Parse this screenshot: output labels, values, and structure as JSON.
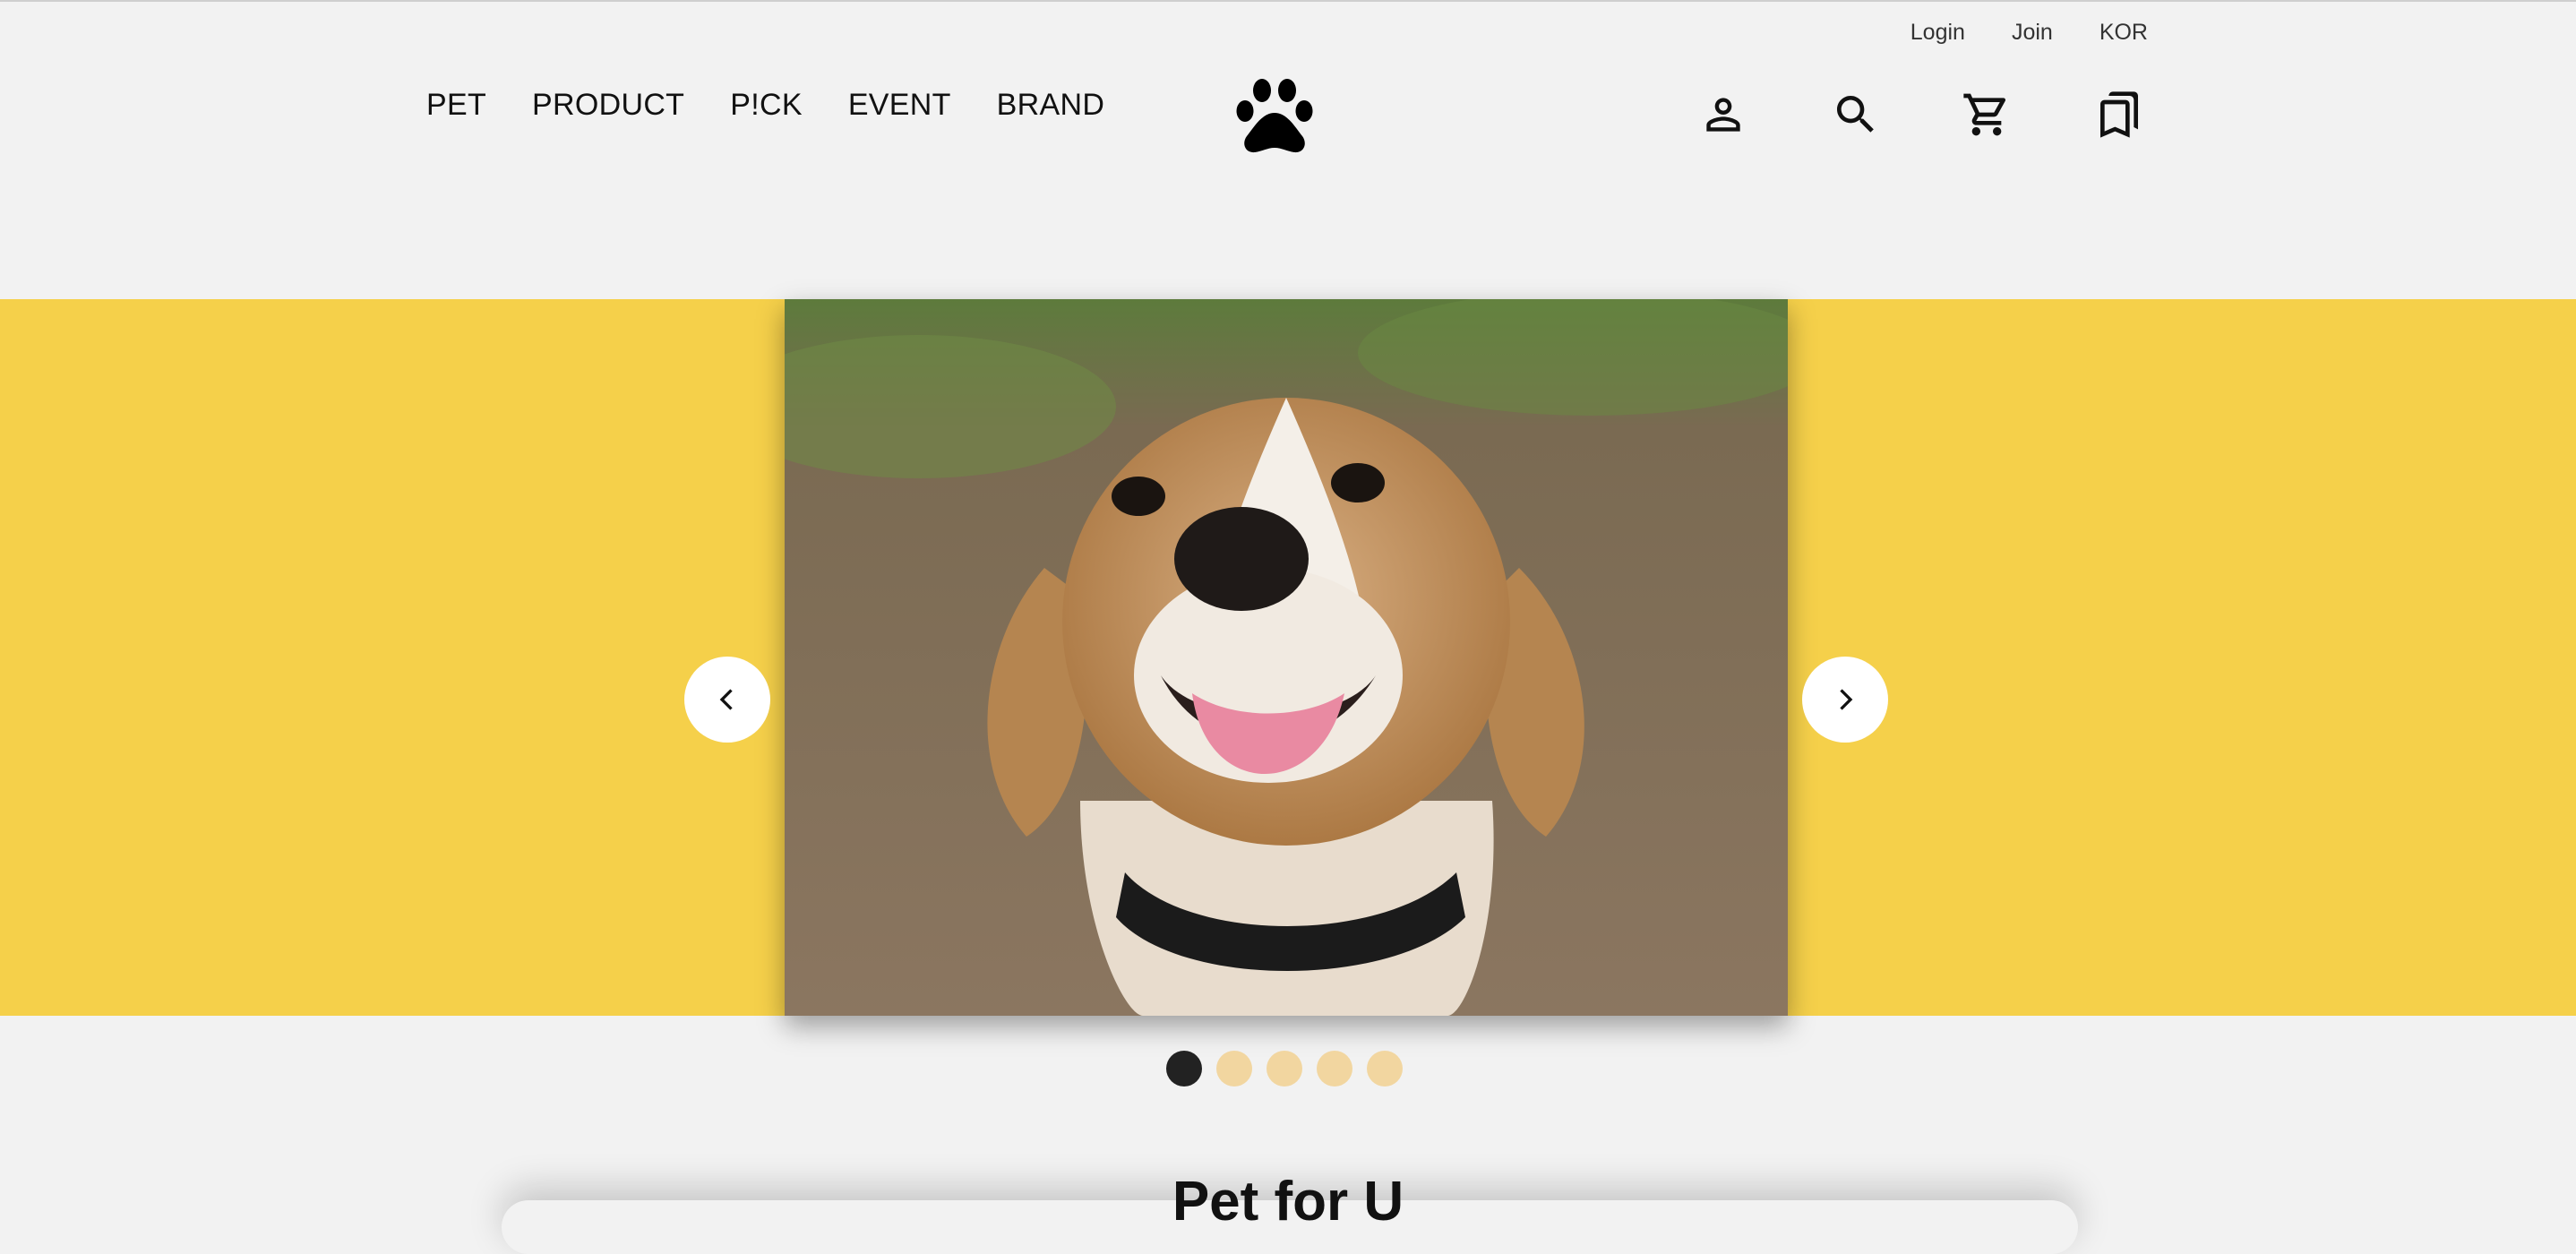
{
  "utility_nav": [
    "Login",
    "Join",
    "KOR"
  ],
  "main_nav": [
    "PET",
    "PRODUCT",
    "P!CK",
    "EVENT",
    "BRAND"
  ],
  "header_icons": [
    "paw-logo-icon",
    "user-icon",
    "search-icon",
    "cart-icon",
    "bookmarks-icon"
  ],
  "carousel": {
    "photo_description": "beagle",
    "slide_count": 5,
    "active_index": 0,
    "banner_color": "#f5d04a",
    "dot_active_color": "#222222",
    "dot_inactive_color": "#f2d6a0",
    "prev_icon": "chevron-left-icon",
    "next_icon": "chevron-right-icon"
  },
  "section": {
    "title": "Pet for U"
  }
}
